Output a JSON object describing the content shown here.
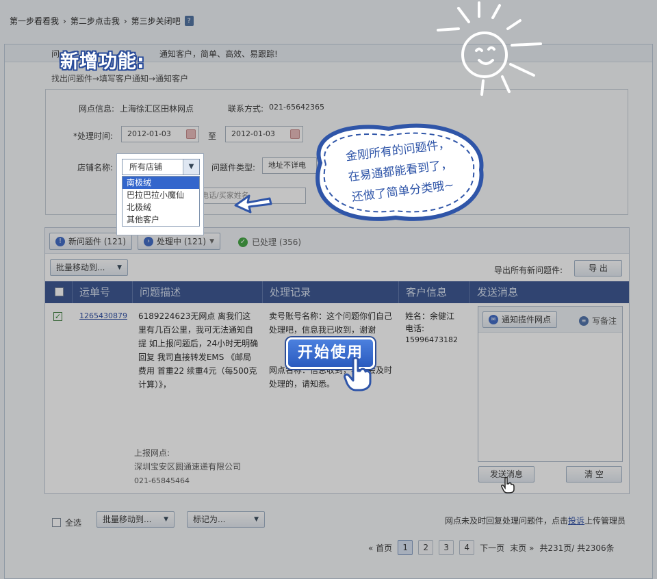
{
  "steps": {
    "s1": "第一步看看我",
    "s2": "第二步点击我",
    "s3": "第三步关闭吧",
    "help": "?"
  },
  "banner": {
    "prefix": "问",
    "text": "通知客户，简单、高效、易跟踪!",
    "title": "新增功能:"
  },
  "flow": "找出问题件→填写客户通知→通知客户",
  "form": {
    "station_label": "网点信息:",
    "station_value": "上海徐汇区田林网点",
    "contact_label": "联系方式:",
    "contact_value": "021-65642365",
    "time_label": "*处理时间:",
    "date_from": "2012-01-03",
    "to": "至",
    "date_to": "2012-01-03",
    "shop_label": "店铺名称:",
    "shop_selected": "所有店铺",
    "shop_options": [
      "南极绒",
      "巴拉巴拉小魔仙",
      "北极绒",
      "其他客户"
    ],
    "issue_type_label": "问题件类型:",
    "issue_type_value": "地址不详电",
    "search_placeholder": "电话/买家姓名"
  },
  "tabs": {
    "new": "新问题件 (121)",
    "processing": "处理中 (121)",
    "done": "已处理 (356)"
  },
  "bulk_move": "批量移动到...",
  "export_label": "导出所有新问题件:",
  "export_btn": "导 出",
  "columns": {
    "waybill": "运单号",
    "desc": "问题描述",
    "record": "处理记录",
    "customer": "客户信息",
    "send": "发送消息"
  },
  "row": {
    "waybill": "1265430879",
    "desc": "6189224623无网点  离我们这里有几百公里，我可无法通知自提  如上报问题后，24小时无明确回复  我司直接转发EMS 《邮局费用 首重22 续重4元（每500克计算）》，",
    "record_1": "卖号账号名称：这个问题你们自己处理吧，信息我已收到，谢谢",
    "record_2": "网点名称：信息收到，我们会及时处理的，请知悉。",
    "customer_name": "姓名：余健江",
    "customer_phone_label": "电话:",
    "customer_phone": "15996473182",
    "report_label": "上报网点:",
    "report_station": "深圳宝安区圆通速递有限公司",
    "report_phone": "021-65845464"
  },
  "msg": {
    "notify": "通知揽件网点",
    "note": "写备注",
    "send": "发送消息",
    "clear": "清 空"
  },
  "footer": {
    "select_all": "全选",
    "bulk_move": "批量移动到...",
    "mark_as": "标记为...",
    "notice_pre": "网点未及时回复处理问题件，点击",
    "notice_link": "投诉",
    "notice_post": "上传管理员",
    "first": "« 首页",
    "pages": [
      "1",
      "2",
      "3",
      "4"
    ],
    "next": "下一页",
    "last": "末页 »",
    "total": "共231页/ 共2306条"
  },
  "cloud": {
    "line1": "金刚所有的问题件，",
    "line2": "在易通都能看到了，",
    "line3": "还做了简单分类哦~"
  },
  "start_btn": "开始使用"
}
